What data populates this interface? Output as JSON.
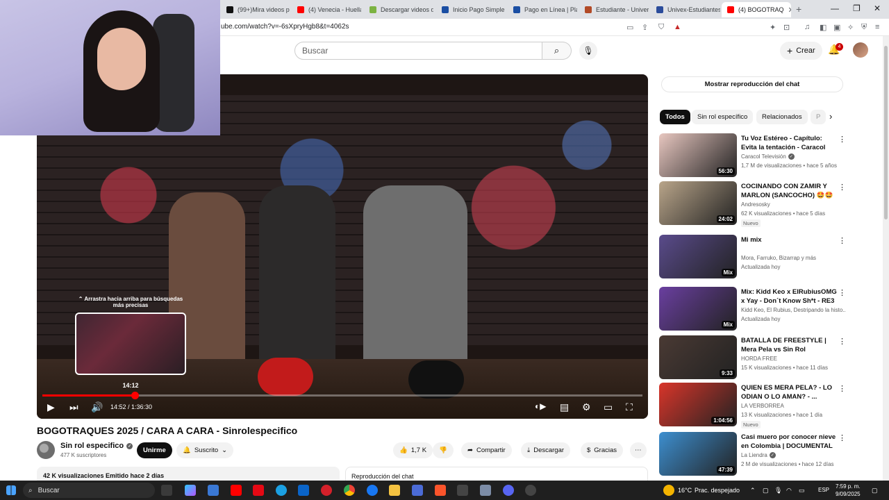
{
  "browser": {
    "tabs": [
      {
        "label": "(99+)Mira videos p",
        "color": "#111111"
      },
      {
        "label": "(4) Venecia - Huella",
        "color": "#ff0000"
      },
      {
        "label": "Descargar videos de",
        "color": "#7cb342"
      },
      {
        "label": "Inicio Pago Simple |",
        "color": "#1a4ea3"
      },
      {
        "label": "Pago en Línea | Plan",
        "color": "#1a4ea3"
      },
      {
        "label": "Estudiante - Univer",
        "color": "#b24a26"
      },
      {
        "label": "Univex-Estudiantes",
        "color": "#2b4c9b"
      },
      {
        "label": "(4) BOGOTRAQ",
        "color": "#ff0000"
      }
    ],
    "url": "ube.com/watch?v=-6sXpryHgb8&t=4062s"
  },
  "header": {
    "search_placeholder": "Buscar",
    "create_label": "Crear",
    "notification_count": "4"
  },
  "player": {
    "hover_hint": "⌃ Arrastra hacia arriba para búsquedas más precisas",
    "preview_time": "14:12",
    "time_display": "14:52 / 1:36:30",
    "progress_fraction": 0.154
  },
  "video": {
    "title": "BOGOTRAQUES 2025 / CARA A CARA - Sinrolespecifico",
    "channel": "Sin rol especifico",
    "subscribers": "477 K suscriptores",
    "join_label": "Unirme",
    "subscribed_label": "Suscrito",
    "likes": "1,7 K",
    "share_label": "Compartir",
    "download_label": "Descargar",
    "thanks_label": "Gracias",
    "description_stats": "42 K visualizaciones  Emitido hace 2 días",
    "chat_replay_label": "Reproducción del chat"
  },
  "sidebar": {
    "show_chat_label": "Mostrar reproducción del chat",
    "chips": [
      "Todos",
      "Sin rol específico",
      "Relacionados",
      "P"
    ],
    "recommendations": [
      {
        "title": "Tu Voz Estéreo - Capítulo: Evita la tentación - Caracol Televisión",
        "channel": "Caracol Televisión",
        "verified": true,
        "meta": "1,7 M de visualizaciones • hace 5 años",
        "duration": "56:30",
        "badge": "",
        "thumb": "#e8c7c0"
      },
      {
        "title": "COCINANDO CON ZAMIR Y MARLON (SANCOCHO) 🤩🤩",
        "channel": "Andresosky",
        "verified": false,
        "meta": "62 K visualizaciones • hace 5 días",
        "duration": "24:02",
        "badge": "Nuevo",
        "thumb": "#b9a58a"
      },
      {
        "title": "Mi mix",
        "channel": "Mora, Farruko, Bizarrap y más",
        "verified": false,
        "meta": "Actualizada hoy",
        "duration": "Mix",
        "badge": "",
        "thumb": "#5a4b8c"
      },
      {
        "title": "Mix: Kidd Keo x ElRubiusOMG x Yay - Don´t Know Sh*t - RE3 ...",
        "channel": "Kidd Keo, El Rubius, Destripando la histo...",
        "verified": false,
        "meta": "Actualizada hoy",
        "duration": "Mix",
        "badge": "",
        "thumb": "#6a3fa0"
      },
      {
        "title": "BATALLA DE FREESTYLE | Mera Pela vs Sin Rol Especifico | ...",
        "channel": "HORDA FREE",
        "verified": false,
        "meta": "15 K visualizaciones • hace 11 días",
        "duration": "9:33",
        "badge": "",
        "thumb": "#4a3a34"
      },
      {
        "title": "QUIEN ES MERA PELA? - LO ODIAN O LO AMAN? - ...",
        "channel": "LA VERBORREA",
        "verified": false,
        "meta": "13 K visualizaciones • hace 1 día",
        "duration": "1:04:56",
        "badge": "Nuevo",
        "thumb": "#d9352a"
      },
      {
        "title": "Casi muero por conocer nieve en Colombia | DOCUMENTAL",
        "channel": "La Liendra",
        "verified": true,
        "meta": "2 M de visualizaciones • hace 12 días",
        "duration": "47:39",
        "badge": "",
        "thumb": "#3d8fd0"
      }
    ]
  },
  "taskbar": {
    "search_label": "Buscar",
    "weather": "16°C",
    "weather_desc": "Prac. despejado",
    "lang": "ESP",
    "time": "7:59 p. m.",
    "date": "9/09/2025"
  }
}
